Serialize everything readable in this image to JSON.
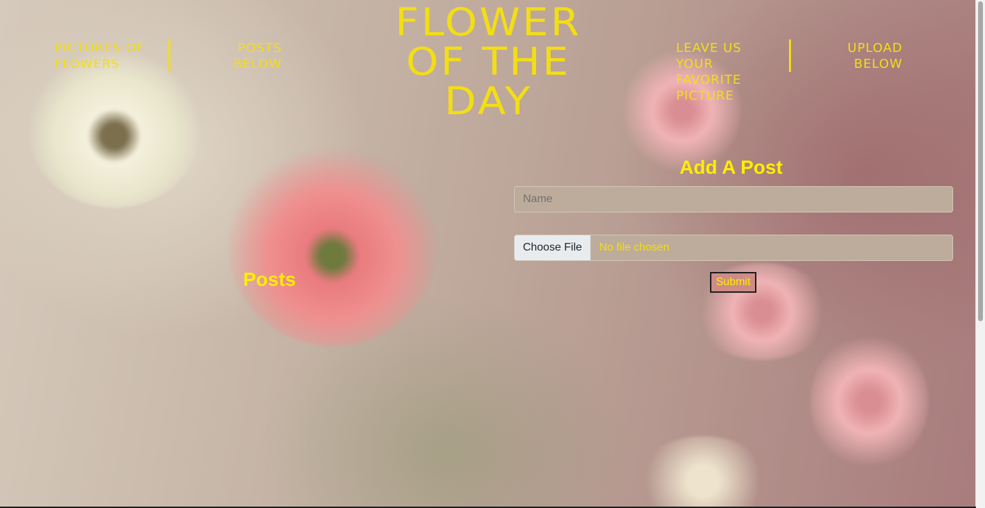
{
  "nav": {
    "left": [
      {
        "label": "PICTURES OF FLOWERS"
      },
      {
        "label": "POSTS BELOW"
      }
    ],
    "title": "FLOWER\nOF THE\nDAY",
    "right": [
      {
        "label": "LEAVE US YOUR FAVORITE PICTURE"
      },
      {
        "label": "UPLOAD BELOW"
      }
    ]
  },
  "posts": {
    "heading": "Posts"
  },
  "add_post": {
    "heading": "Add A Post",
    "name_placeholder": "Name",
    "name_value": "",
    "choose_file_label": "Choose File",
    "file_status": "No file chosen",
    "submit_label": "Submit"
  },
  "colors": {
    "accent_yellow": "#f3de14",
    "heading_yellow": "#ffee00",
    "input_background": "#bdac9b",
    "submit_background": "#ce8c86"
  },
  "icons": [
    "scrollbar-thumb"
  ]
}
